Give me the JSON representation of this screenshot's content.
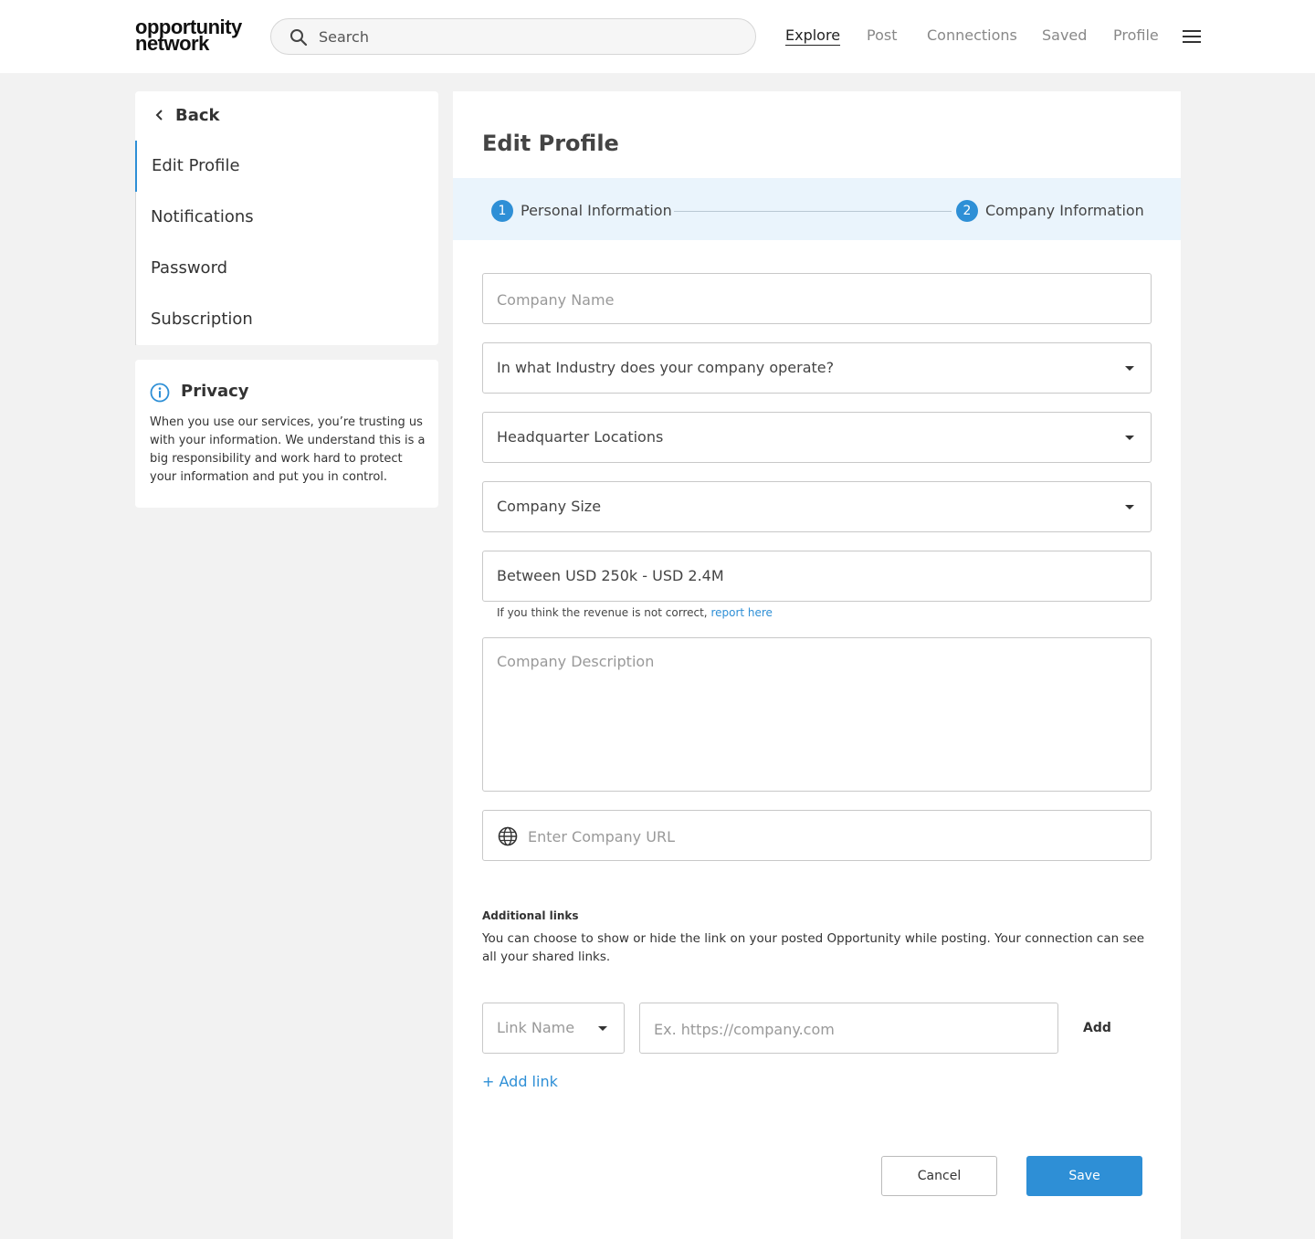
{
  "logo": {
    "line1": "opportunity",
    "line2": "network"
  },
  "search": {
    "placeholder": "Search"
  },
  "nav": [
    {
      "label": "Explore",
      "active": true
    },
    {
      "label": "Post"
    },
    {
      "label": "Connections"
    },
    {
      "label": "Saved"
    },
    {
      "label": "Profile"
    }
  ],
  "sidebar": {
    "back_label": "Back",
    "items": [
      "Edit Profile",
      "Notifications",
      "Password",
      "Subscription"
    ]
  },
  "privacy": {
    "title": "Privacy",
    "text": "When you use our services, you’re trusting us with your information. We understand this is a big responsibility and work hard to protect your information and put you in control."
  },
  "main": {
    "title": "Edit Profile",
    "steps": [
      {
        "number": "1",
        "label": "Personal Information"
      },
      {
        "number": "2",
        "label": "Company Information"
      }
    ]
  },
  "form": {
    "company_name_placeholder": "Company Name",
    "industry_label": "In what Industry does your company operate?",
    "hq_label": "Headquarter Locations",
    "size_label": "Company Size",
    "revenue_value": "Between USD 250k - USD 2.4M",
    "revenue_help": "If you think the revenue is not correct,",
    "revenue_report_link": "report here",
    "description_placeholder": "Company Description",
    "url_placeholder": "Enter Company URL"
  },
  "additional_links": {
    "title": "Additional links",
    "description": "You can choose to show or hide the link on your posted Opportunity while posting. Your connection can see all your shared links.",
    "link_name_placeholder": "Link Name",
    "link_url_placeholder": "Ex. https://company.com",
    "add_label": "Add",
    "add_link_label": "+ Add link"
  },
  "actions": {
    "cancel_label": "Cancel",
    "save_label": "Save"
  },
  "colors": {
    "accent": "#2e8fd6",
    "stepper_bg": "#eaf4fc",
    "page_bg": "#f2f2f2"
  },
  "icons": [
    "search-icon",
    "menu-icon",
    "chevron-left-icon",
    "info-icon",
    "globe-icon",
    "caret-down-icon"
  ]
}
